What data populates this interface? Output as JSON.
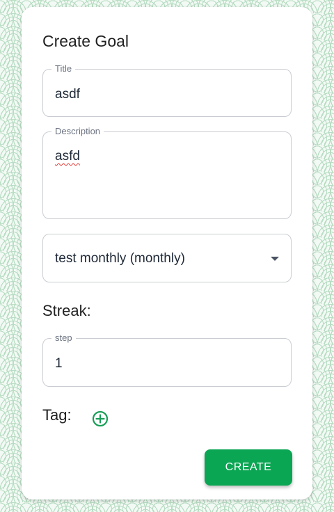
{
  "form": {
    "heading": "Create Goal",
    "title_field": {
      "label": "Title",
      "value": "asdf"
    },
    "description_field": {
      "label": "Description",
      "value": "asfd"
    },
    "goal_select": {
      "selected": "test monthly (monthly)"
    },
    "streak": {
      "label": "Streak:"
    },
    "step_field": {
      "label": "step",
      "value": "1"
    },
    "tag": {
      "label": "Tag:",
      "add_icon": "plus-circle-icon"
    },
    "create_label": "CREATE"
  },
  "colors": {
    "accent": "#0aa653",
    "add_icon": "#179e57",
    "background_pattern": "#b9ddc4"
  }
}
